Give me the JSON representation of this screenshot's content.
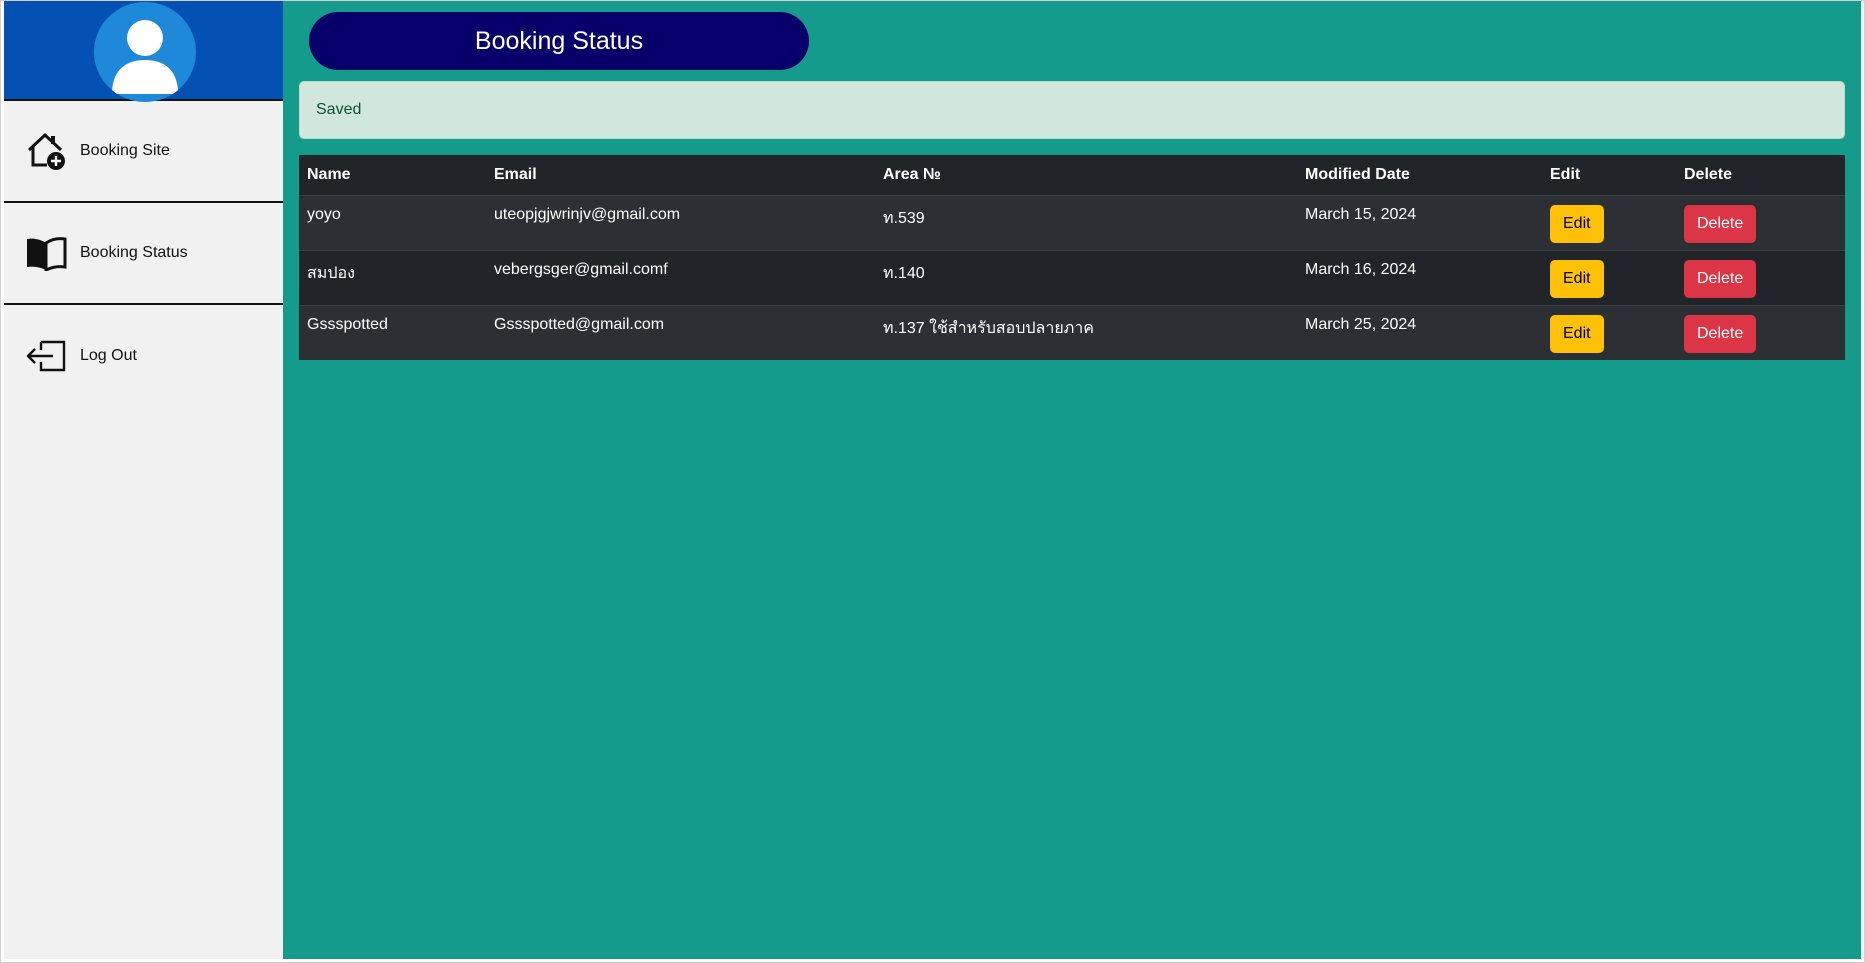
{
  "sidebar": {
    "items": [
      {
        "label": "Booking Site",
        "icon": "house-add-icon"
      },
      {
        "label": "Booking Status",
        "icon": "book-icon"
      },
      {
        "label": "Log Out",
        "icon": "logout-icon"
      }
    ]
  },
  "main": {
    "title": "Booking Status",
    "alert": "Saved",
    "table": {
      "headers": [
        "Name",
        "Email",
        "Area №",
        "Modified Date",
        "Edit",
        "Delete"
      ],
      "rows": [
        {
          "name": "yoyo",
          "email": "uteopjgjwrinjv@gmail.com",
          "area": "ท.539",
          "date": "March 15, 2024",
          "edit": "Edit",
          "delete": "Delete"
        },
        {
          "name": "สมปอง",
          "email": "vebergsger@gmail.comf",
          "area": "ท.140",
          "date": "March 16, 2024",
          "edit": "Edit",
          "delete": "Delete"
        },
        {
          "name": "Gssspotted",
          "email": "Gssspotted@gmail.com",
          "area": "ท.137 ใช้สำหรับสอบปลายภาค",
          "date": "March 25, 2024",
          "edit": "Edit",
          "delete": "Delete"
        }
      ]
    }
  },
  "colors": {
    "sidebar_header": "#0352b3",
    "main_bg": "#149b8c",
    "title_pill": "#08006a",
    "edit_button": "#ffc107",
    "delete_button": "#dc3545"
  }
}
